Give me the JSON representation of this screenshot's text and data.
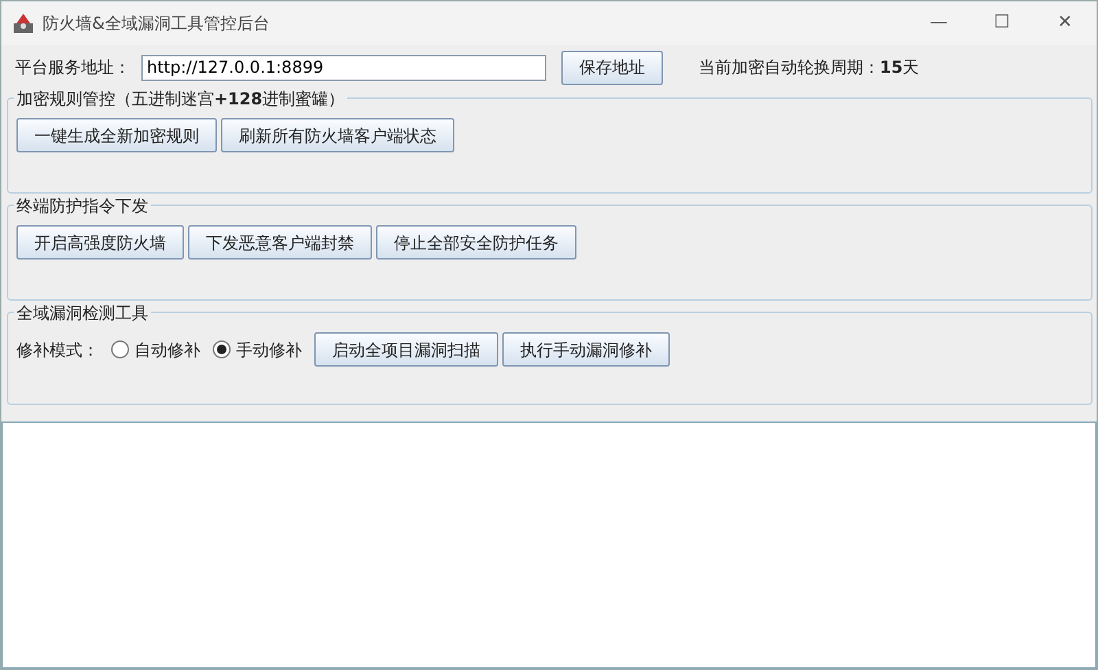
{
  "window": {
    "title": "防火墙&全域漏洞工具管控后台",
    "controls": [
      "—",
      "☐",
      "✕"
    ]
  },
  "address": {
    "label": "平台服务地址：",
    "value": "http://127.0.0.1:8899",
    "button": "保存地址",
    "rotation": "当前加密自动轮换周期：**15**天"
  },
  "groups": [
    {
      "title": "加密规则管控（五进制迷宫**+128**进制蜜罐）",
      "items": [
        {
          "kind": "button",
          "label": "一键生成全新加密规则"
        },
        {
          "kind": "button",
          "label": "刷新所有防火墙客户端状态"
        }
      ]
    },
    {
      "title": "终端防护指令下发",
      "items": [
        {
          "kind": "button",
          "label": "开启高强度防火墙"
        },
        {
          "kind": "button",
          "label": "下发恶意客户端封禁"
        },
        {
          "kind": "button",
          "label": "停止全部安全防护任务"
        }
      ]
    },
    {
      "title": "全域漏洞检测工具",
      "items": [
        {
          "kind": "label",
          "label": "修补模式："
        },
        {
          "kind": "radio",
          "label": "自动修补",
          "selected": false
        },
        {
          "kind": "radio",
          "label": "手动修补",
          "selected": true
        },
        {
          "kind": "button",
          "label": "启动全项目漏洞扫描"
        },
        {
          "kind": "button",
          "label": "执行手动漏洞修补"
        }
      ]
    }
  ]
}
